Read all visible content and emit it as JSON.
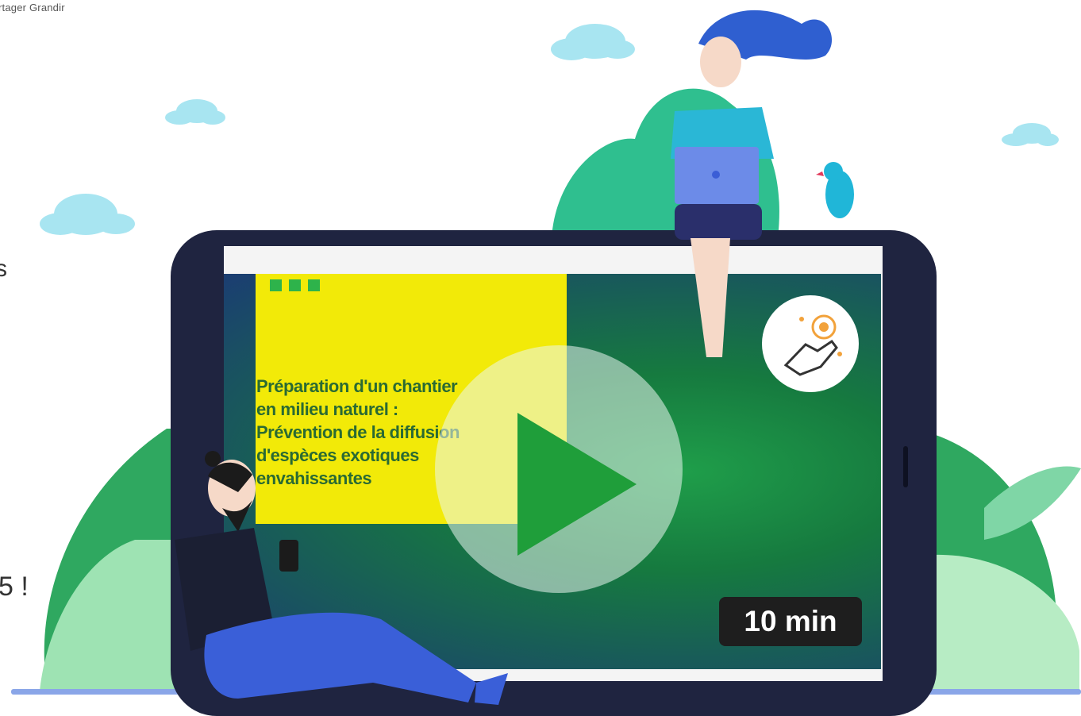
{
  "header": {
    "brand_text": "rtager Grandir"
  },
  "side_fragments": {
    "top": "s",
    "bottom": "5 !"
  },
  "video": {
    "title_lines": [
      "Préparation d'un chantier",
      "en milieu naturel :",
      "Prévention de la diffusion",
      "d'espèces exotiques",
      "envahissantes"
    ],
    "duration": "10 min",
    "play_icon": "play-icon",
    "badge_icon": "hand-click-icon"
  },
  "colors": {
    "title_card": "#f2ea08",
    "play_triangle": "#1f9e3a",
    "tablet_frame": "#1f2440",
    "ground": "#8aa6e8"
  }
}
